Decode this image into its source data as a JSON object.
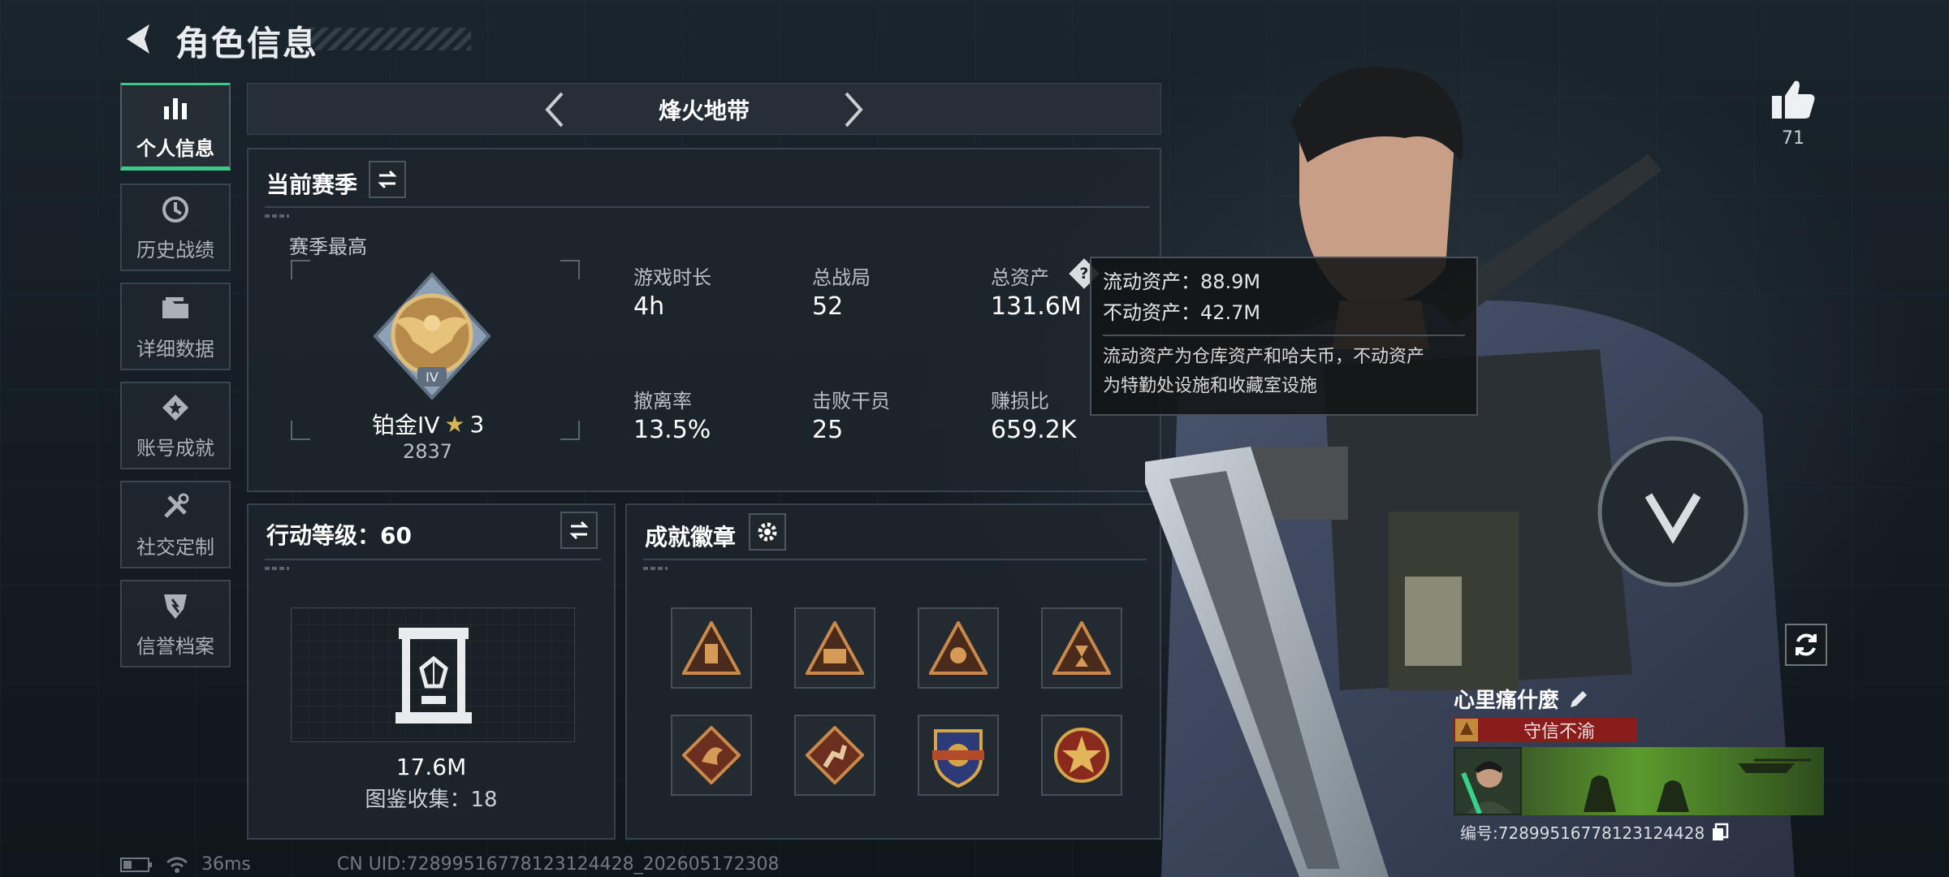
{
  "header": {
    "title": "角色信息"
  },
  "sidebar": {
    "items": [
      {
        "label": "个人信息",
        "icon": "bar-chart-icon",
        "active": true
      },
      {
        "label": "历史战绩",
        "icon": "history-icon",
        "active": false
      },
      {
        "label": "详细数据",
        "icon": "folder-icon",
        "active": false
      },
      {
        "label": "账号成就",
        "icon": "achievement-icon",
        "active": false
      },
      {
        "label": "社交定制",
        "icon": "tools-icon",
        "active": false
      },
      {
        "label": "信誉档案",
        "icon": "credit-shield-icon",
        "active": false
      }
    ]
  },
  "mode": {
    "name": "烽火地带"
  },
  "season": {
    "title": "当前赛季",
    "best_label": "赛季最高",
    "rank_name": "铂金IV",
    "rank_stars": "3",
    "rank_score": "2837",
    "stats": [
      {
        "label": "游戏时长",
        "value": "4h"
      },
      {
        "label": "总战局",
        "value": "52"
      },
      {
        "label": "总资产",
        "value": "131.6M"
      },
      {
        "label": "撤离率",
        "value": "13.5%"
      },
      {
        "label": "击败干员",
        "value": "25"
      },
      {
        "label": "赚损比",
        "value": "659.2K"
      }
    ]
  },
  "tooltip": {
    "liquid": "流动资产：88.9M",
    "fixed": "不动资产：42.7M",
    "desc_line1": "流动资产为仓库资产和哈夫币，不动资产",
    "desc_line2": "为特勤处设施和收藏室设施"
  },
  "action_level": {
    "title": "行动等级：60",
    "value": "17.6M",
    "collection": "图鉴收集：18"
  },
  "badges": {
    "title": "成就徽章"
  },
  "likes": {
    "count": "71"
  },
  "player": {
    "name": "心里痛什麼",
    "honor": "守信不渝",
    "id": "编号:7289951677812312442​8"
  },
  "status": {
    "ping": "36ms",
    "uid": "CN UID:7289951677812312442​8_202605172308"
  },
  "colors": {
    "accent": "#3dc98a",
    "honor_bg": "#8b1c1c"
  }
}
